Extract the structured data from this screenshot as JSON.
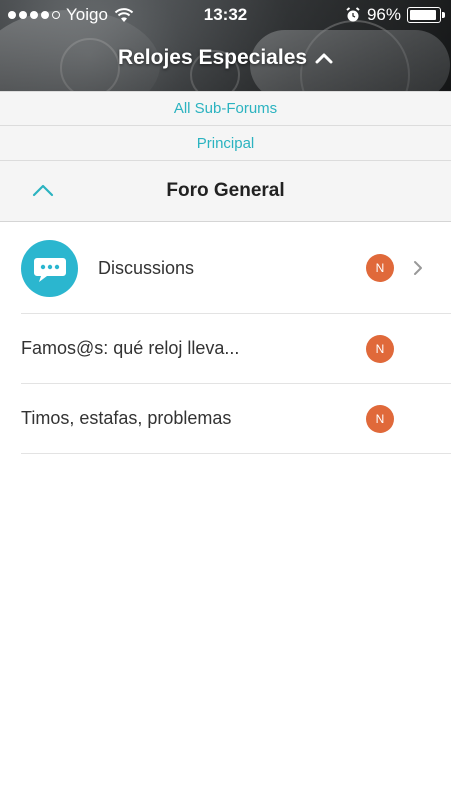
{
  "status_bar": {
    "carrier": "Yoigo",
    "time": "13:32",
    "battery": "96%",
    "battery_level": 0.96,
    "signal_bars_filled": 4,
    "signal_bars_total": 5
  },
  "header": {
    "title": "Relojes Especiales"
  },
  "breadcrumbs": [
    {
      "label": "All Sub-Forums"
    },
    {
      "label": "Principal"
    }
  ],
  "section": {
    "title": "Foro General"
  },
  "list": [
    {
      "label": "Discussions",
      "badge": "N",
      "icon": "chat-bubble-icon"
    },
    {
      "label": "Famos@s: qué reloj lleva...",
      "badge": "N"
    },
    {
      "label": "Timos, estafas, problemas",
      "badge": "N"
    }
  ],
  "colors": {
    "accent": "#2bb3c0",
    "badge": "#e0693a",
    "discussion_icon_bg": "#2bb6cf"
  }
}
